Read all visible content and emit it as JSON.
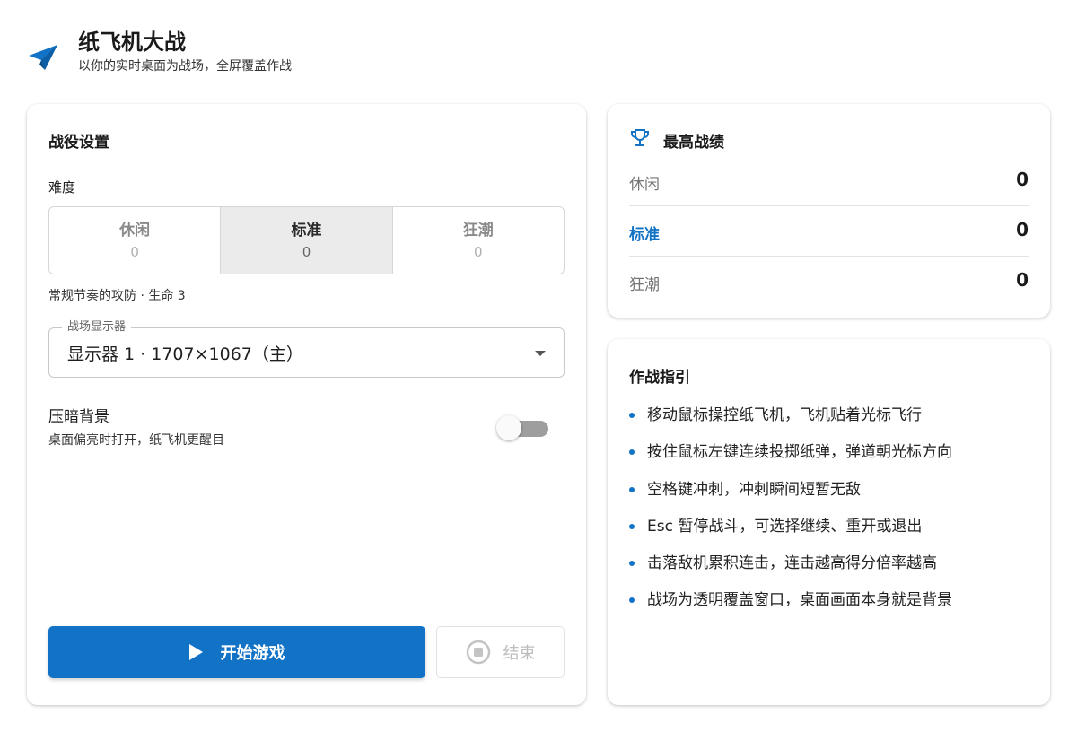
{
  "header": {
    "title": "纸飞机大战",
    "subtitle": "以你的实时桌面为战场，全屏覆盖作战",
    "logo_icon": "paper-plane-icon",
    "accent": "#1273c6"
  },
  "settings": {
    "title": "战役设置",
    "difficulty_label": "难度",
    "difficulties": [
      {
        "name": "休闲",
        "count": "0",
        "selected": false
      },
      {
        "name": "标准",
        "count": "0",
        "selected": true
      },
      {
        "name": "狂潮",
        "count": "0",
        "selected": false
      }
    ],
    "difficulty_desc": "常规节奏的攻防 · 生命 3",
    "monitor": {
      "legend": "战场显示器",
      "value": "显示器 1 · 1707×1067（主）"
    },
    "dim_background": {
      "title": "压暗背景",
      "desc": "桌面偏亮时打开，纸飞机更醒目",
      "enabled": false
    },
    "start_label": "开始游戏",
    "end_label": "结束"
  },
  "scores": {
    "title": "最高战绩",
    "rows": [
      {
        "label": "休闲",
        "value": "0"
      },
      {
        "label": "标准",
        "value": "0"
      },
      {
        "label": "狂潮",
        "value": "0"
      }
    ]
  },
  "guide": {
    "title": "作战指引",
    "items": [
      "移动鼠标操控纸飞机，飞机贴着光标飞行",
      "按住鼠标左键连续投掷纸弹，弹道朝光标方向",
      "空格键冲刺，冲刺瞬间短暂无敌",
      "Esc 暂停战斗，可选择继续、重开或退出",
      "击落敌机累积连击，连击越高得分倍率越高",
      "战场为透明覆盖窗口，桌面画面本身就是背景"
    ]
  }
}
